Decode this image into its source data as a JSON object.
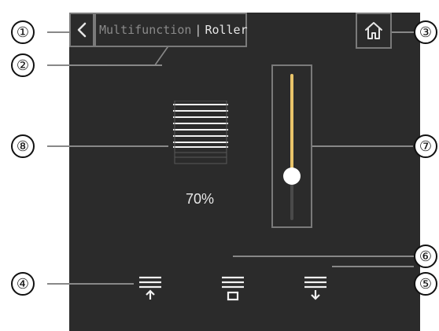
{
  "header": {
    "breadcrumb_parent": "Multifunction",
    "separator": "|",
    "breadcrumb_current": "Roller"
  },
  "blind": {
    "position_percent": 70,
    "position_label": "70%"
  },
  "slider": {
    "value_fraction": 0.3
  },
  "callouts": [
    "①",
    "②",
    "③",
    "④",
    "⑤",
    "⑥",
    "⑦",
    "⑧"
  ],
  "colors": {
    "panel": "#2b2b2b",
    "accent": "#e9c46a",
    "border": "#7a7a7a"
  },
  "icons": {
    "back": "chevron-left-icon",
    "home": "home-icon",
    "open": "blind-up-icon",
    "stop": "blind-stop-icon",
    "close": "blind-down-icon",
    "status": "roller-blind-icon"
  }
}
